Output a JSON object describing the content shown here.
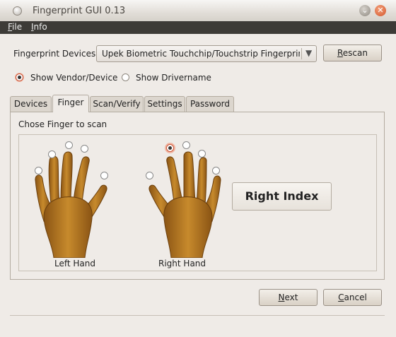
{
  "window": {
    "title": "Fingerprint GUI 0.13"
  },
  "menu": [
    {
      "label": "File",
      "mnemonic": "F",
      "rest": "ile"
    },
    {
      "label": "Info",
      "mnemonic": "I",
      "rest": "nfo"
    }
  ],
  "devices": {
    "label": "Fingerprint Devices:",
    "selected": "Upek Biometric Touchchip/Touchstrip Fingerprint Sensor",
    "rescan_mnemonic": "R",
    "rescan_rest": "escan"
  },
  "display_options": [
    {
      "label": "Show Vendor/Device",
      "selected": true
    },
    {
      "label": "Show Drivername",
      "selected": false
    }
  ],
  "tabs": [
    {
      "label": "Devices",
      "active": false
    },
    {
      "label": "Finger",
      "active": true
    },
    {
      "label": "Scan/Verify",
      "active": false
    },
    {
      "label": "Settings",
      "active": false
    },
    {
      "label": "Password",
      "active": false
    }
  ],
  "finger_panel": {
    "heading": "Chose Finger to scan",
    "left_hand_label": "Left Hand",
    "right_hand_label": "Right Hand",
    "selected_finger": "Right Index",
    "left_hand_fingers": [
      {
        "name": "left-little",
        "selected": false
      },
      {
        "name": "left-ring",
        "selected": false
      },
      {
        "name": "left-middle",
        "selected": false
      },
      {
        "name": "left-index",
        "selected": false
      },
      {
        "name": "left-thumb",
        "selected": false
      }
    ],
    "right_hand_fingers": [
      {
        "name": "right-thumb",
        "selected": false
      },
      {
        "name": "right-index",
        "selected": true
      },
      {
        "name": "right-middle",
        "selected": false
      },
      {
        "name": "right-ring",
        "selected": false
      },
      {
        "name": "right-little",
        "selected": false
      }
    ]
  },
  "buttons": {
    "next_mnemonic": "N",
    "next_rest": "ext",
    "cancel_mnemonic": "C",
    "cancel_rest": "ancel"
  },
  "colors": {
    "skin": "#b5741f",
    "skin_dark": "#7a4a12",
    "selected_radio": "#c8573a"
  }
}
